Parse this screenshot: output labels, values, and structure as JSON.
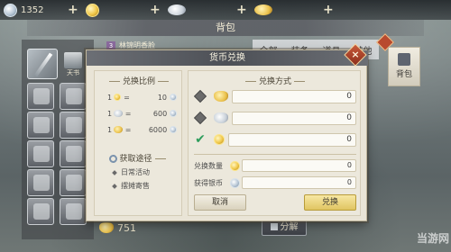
{
  "topbar": {
    "currencies": [
      {
        "name": "moon-coin",
        "amount": "1352"
      },
      {
        "name": "gold-coin",
        "amount": ""
      },
      {
        "name": "silver-ingot",
        "amount": ""
      },
      {
        "name": "gold-ingot",
        "amount": ""
      }
    ],
    "plus": "+"
  },
  "bag": {
    "title": "背包",
    "subtitle_index": "3",
    "subtitle": "林锦明香脸",
    "tabs": [
      "全部",
      "装备",
      "道具",
      "其他"
    ],
    "side_tab": "背包",
    "tianshu_label": "天书",
    "ingot_count": "751",
    "decompose_label": "分解"
  },
  "dialog": {
    "title": "货币兑换",
    "rate_head": "兑换比例",
    "rates": [
      {
        "left": "1",
        "eq": "=",
        "right": "10"
      },
      {
        "left": "1",
        "eq": "=",
        "right": "600"
      },
      {
        "left": "1",
        "eq": "=",
        "right": "6000"
      }
    ],
    "source_head": "获取途径",
    "sources": [
      "日常活动",
      "摆摊寄售"
    ],
    "method_head": "兑换方式",
    "options": [
      {
        "value": "0",
        "selected": false
      },
      {
        "value": "0",
        "selected": false
      },
      {
        "value": "0",
        "selected": true
      }
    ],
    "qty_label": "兑换数量",
    "qty_value": "0",
    "get_label": "获得银币",
    "get_value": "0",
    "cancel": "取消",
    "confirm": "兑换",
    "close": "×"
  },
  "watermark": "当游网",
  "colors": {
    "accent_green": "#2e9d5c",
    "confirm_gold": "#e0c562",
    "title_bar": "#4d5056"
  }
}
